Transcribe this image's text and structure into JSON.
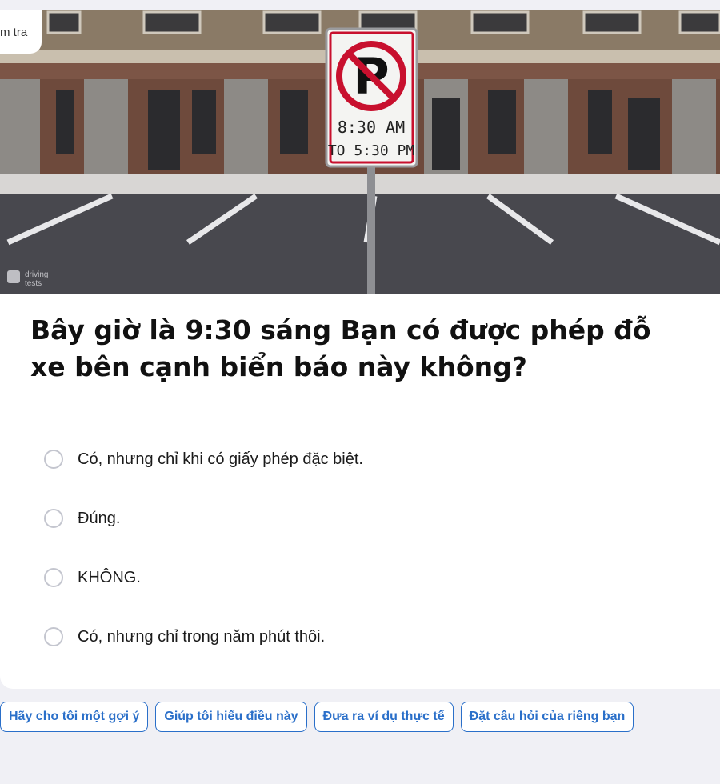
{
  "header": {
    "tab_label": "m tra"
  },
  "image": {
    "sign_time_start": "8:30 AM",
    "sign_time_end": "TO 5:30 PM",
    "watermark_line1": "driving",
    "watermark_line2": "tests"
  },
  "question": {
    "text": "Bây giờ là 9:30 sáng Bạn có được phép đỗ xe bên cạnh biển báo này không?"
  },
  "options": [
    {
      "label": "Có, nhưng chỉ khi có giấy phép đặc biệt."
    },
    {
      "label": "Đúng."
    },
    {
      "label": "KHÔNG."
    },
    {
      "label": "Có, nhưng chỉ trong năm phút thôi."
    }
  ],
  "actions": [
    {
      "label": "Hãy cho tôi một gợi ý"
    },
    {
      "label": "Giúp tôi hiểu điều này"
    },
    {
      "label": "Đưa ra ví dụ thực tế"
    },
    {
      "label": "Đặt câu hỏi của riêng bạn"
    }
  ],
  "colors": {
    "accent": "#2a6fc9",
    "page_bg": "#f0f0f5",
    "card_bg": "#ffffff",
    "radio_border": "#c4c6cf"
  }
}
